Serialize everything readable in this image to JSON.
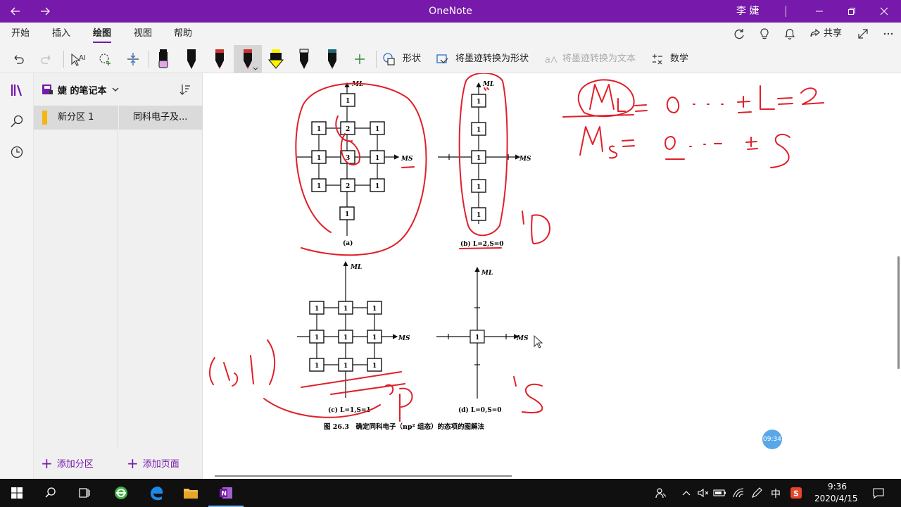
{
  "window": {
    "title": "OneNote",
    "user": "李 婕"
  },
  "menu": {
    "tabs": [
      "开始",
      "插入",
      "绘图",
      "视图",
      "帮助"
    ],
    "active_tab": "绘图",
    "share_label": "共享"
  },
  "toolbar": {
    "shape_label": "形状",
    "ink_to_shape_label": "将墨迹转换为形状",
    "ink_to_text_label": "将墨迹转换为文本",
    "math_label": "数学",
    "pens": [
      {
        "name": "pen-pink-highlighter",
        "color": "#e2a6e8"
      },
      {
        "name": "pen-black-1",
        "color": "#111111"
      },
      {
        "name": "pen-red-1",
        "color": "#d0302f"
      },
      {
        "name": "pen-red-selected",
        "color": "#d0302f"
      },
      {
        "name": "pen-yellow-highlighter",
        "color": "#fff200"
      },
      {
        "name": "pen-black-2",
        "color": "#222222"
      },
      {
        "name": "pen-teal",
        "color": "#1b6b78"
      }
    ]
  },
  "notebook": {
    "title": "婕 的笔记本",
    "section": "新分区 1",
    "page": "同科电子及...",
    "add_section_label": "添加分区",
    "add_page_label": "添加页面"
  },
  "figure": {
    "panel_a_label": "(a)",
    "panel_b_label": "(b) L=2,S=0",
    "panel_c_label": "(c) L=1,S=1",
    "panel_d_label": "(d) L=0,S=0",
    "caption": "图 26.3　确定同科电子（np² 组态）的态项的图解法",
    "axis_ml": "ML",
    "axis_ms": "MS",
    "grid_a": [
      [
        "1",
        "2",
        "1"
      ],
      [
        "1",
        "3",
        "1"
      ],
      [
        "1",
        "2",
        "1"
      ]
    ],
    "grid_a_top": "1",
    "grid_a_bottom": "1",
    "col_b": [
      "1",
      "1",
      "1",
      "1",
      "1"
    ],
    "grid_c": [
      [
        "1",
        "1",
        "1"
      ],
      [
        "1",
        "1",
        "1"
      ],
      [
        "1",
        "1",
        "1"
      ]
    ],
    "cell_d": "1"
  },
  "ink": {
    "line1": "ML = 0 · · · ±L = 2",
    "line2": "MS = 0 · · · ±S",
    "label_1d": "¹D",
    "label_3p": "³P",
    "label_1s": "¹S",
    "label_pair": "(1,1)"
  },
  "canvas": {
    "time_badge": "09:34"
  },
  "taskbar": {
    "time": "9:36",
    "date": "2020/4/15",
    "ime": "中"
  },
  "colors": {
    "accent": "#7719aa",
    "ink_red": "#e0202a"
  }
}
